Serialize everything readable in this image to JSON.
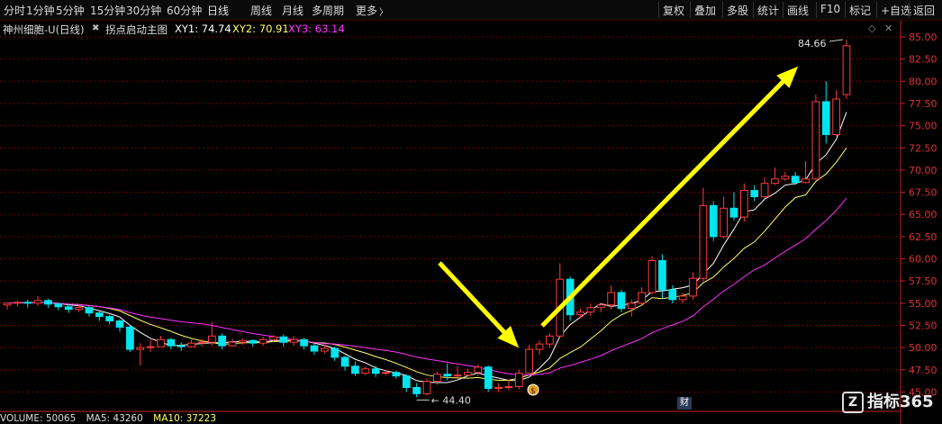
{
  "toolbar": {
    "tabs": [
      "分时",
      "1分钟",
      "5分钟",
      "15分钟",
      "30分钟",
      "60分钟",
      "日线",
      "周线",
      "月线",
      "多周期",
      "更多"
    ],
    "more_arrow": "〉",
    "right_buttons": [
      "复权",
      "叠加",
      "多股",
      "统计",
      "画线",
      "F10",
      "标记",
      "+自选",
      "返回"
    ]
  },
  "title": {
    "stock": "神州细胞-U(日线)",
    "indicator": "拐点启动主图",
    "xy1": "XY1: 74.74",
    "xy2": "XY2: 70.91",
    "xy3": "XY3: 63.14"
  },
  "colors": {
    "up": "#ff3b3b",
    "down": "#00e5ee",
    "ma1": "#ffffff",
    "ma2": "#ffff66",
    "ma3": "#ff33ff",
    "arrow": "#ffff00",
    "grid": "#7a0000",
    "axis": "#cc2222"
  },
  "annotations": {
    "high": "84.66",
    "low": "44.40"
  },
  "icons": {
    "settings": "diamond-icon",
    "close": "close-icon",
    "cash": "money-bag-icon"
  },
  "cai_label": "财",
  "watermark": "指标365",
  "volume": {
    "label": "VOLUME: 50065",
    "ma5": "MA5: 43260",
    "ma10": "MA10: 37223"
  },
  "chart_data": {
    "type": "candlestick",
    "ylim": [
      44.0,
      85.5
    ],
    "yticks": [
      "85.00",
      "82.50",
      "80.00",
      "77.50",
      "75.00",
      "72.50",
      "70.00",
      "67.50",
      "65.00",
      "62.50",
      "60.00",
      "57.50",
      "55.00",
      "52.50",
      "50.00",
      "47.50",
      "45.00"
    ],
    "candles": [
      [
        54.8,
        55.0,
        54.3,
        55.1
      ],
      [
        55.0,
        55.1,
        54.6,
        55.3
      ],
      [
        55.1,
        55.0,
        54.5,
        55.4
      ],
      [
        55.0,
        55.3,
        54.7,
        55.8
      ],
      [
        55.3,
        54.9,
        54.5,
        55.5
      ],
      [
        54.9,
        54.6,
        54.2,
        55.1
      ],
      [
        54.6,
        54.3,
        53.9,
        54.9
      ],
      [
        54.3,
        54.5,
        54.0,
        54.8
      ],
      [
        54.5,
        53.9,
        53.5,
        54.7
      ],
      [
        53.9,
        53.5,
        53.0,
        54.1
      ],
      [
        53.5,
        53.0,
        52.6,
        53.7
      ],
      [
        53.0,
        52.3,
        51.8,
        53.2
      ],
      [
        52.3,
        49.8,
        49.5,
        52.5
      ],
      [
        49.8,
        50.0,
        48.0,
        50.5
      ],
      [
        50.0,
        50.1,
        49.5,
        50.9
      ],
      [
        50.1,
        50.9,
        50.2,
        51.3
      ],
      [
        50.9,
        50.2,
        49.8,
        51.1
      ],
      [
        50.2,
        50.1,
        49.6,
        50.6
      ],
      [
        50.1,
        50.5,
        50.0,
        50.9
      ],
      [
        50.5,
        50.6,
        50.1,
        51.0
      ],
      [
        50.6,
        51.3,
        50.2,
        52.9
      ],
      [
        51.3,
        50.2,
        49.8,
        51.6
      ],
      [
        50.2,
        50.6,
        50.1,
        51.0
      ],
      [
        50.6,
        50.8,
        50.3,
        51.0
      ],
      [
        50.8,
        50.5,
        50.1,
        50.9
      ],
      [
        50.5,
        50.9,
        50.2,
        51.2
      ],
      [
        50.9,
        51.2,
        50.6,
        51.4
      ],
      [
        51.2,
        50.6,
        50.1,
        51.5
      ],
      [
        50.6,
        50.9,
        50.2,
        51.3
      ],
      [
        50.9,
        50.2,
        49.8,
        51.1
      ],
      [
        50.2,
        49.6,
        49.2,
        50.4
      ],
      [
        49.6,
        49.9,
        49.3,
        50.3
      ],
      [
        49.9,
        48.9,
        48.5,
        50.1
      ],
      [
        48.9,
        47.9,
        47.4,
        49.1
      ],
      [
        47.9,
        47.1,
        46.8,
        48.4
      ],
      [
        47.1,
        47.6,
        46.9,
        47.9
      ],
      [
        47.6,
        47.1,
        46.7,
        47.9
      ],
      [
        47.1,
        47.2,
        46.9,
        47.5
      ],
      [
        47.2,
        46.8,
        46.5,
        47.4
      ],
      [
        46.8,
        45.5,
        45.0,
        47.0
      ],
      [
        45.5,
        44.8,
        44.4,
        46.0
      ],
      [
        44.8,
        46.2,
        44.6,
        46.5
      ],
      [
        46.2,
        47.0,
        45.8,
        47.3
      ],
      [
        47.0,
        46.8,
        46.3,
        48.2
      ],
      [
        46.8,
        46.9,
        46.3,
        47.9
      ],
      [
        46.9,
        47.2,
        46.7,
        47.6
      ],
      [
        47.2,
        47.8,
        46.8,
        48.1
      ],
      [
        47.8,
        45.4,
        45.0,
        48.0
      ],
      [
        45.4,
        45.5,
        45.0,
        46.0
      ],
      [
        45.5,
        45.6,
        45.2,
        46.4
      ],
      [
        45.6,
        47.1,
        45.3,
        47.5
      ],
      [
        47.1,
        49.8,
        47.0,
        50.3
      ],
      [
        49.8,
        50.4,
        49.2,
        50.8
      ],
      [
        50.4,
        51.3,
        50.0,
        51.6
      ],
      [
        51.3,
        57.7,
        51.2,
        59.5
      ],
      [
        57.7,
        53.7,
        53.0,
        58.0
      ],
      [
        53.7,
        54.0,
        53.3,
        54.4
      ],
      [
        54.0,
        54.5,
        53.5,
        54.9
      ],
      [
        54.5,
        54.8,
        54.0,
        55.0
      ],
      [
        54.8,
        56.2,
        54.3,
        57.0
      ],
      [
        56.2,
        54.4,
        54.0,
        56.5
      ],
      [
        54.4,
        55.0,
        53.5,
        55.4
      ],
      [
        55.0,
        56.2,
        54.8,
        56.8
      ],
      [
        56.2,
        59.8,
        56.0,
        60.3
      ],
      [
        59.8,
        56.5,
        55.5,
        60.5
      ],
      [
        56.5,
        55.4,
        55.0,
        57.0
      ],
      [
        55.4,
        55.8,
        55.0,
        56.2
      ],
      [
        55.8,
        57.8,
        55.4,
        58.5
      ],
      [
        57.8,
        66.0,
        57.5,
        68.0
      ],
      [
        66.0,
        62.5,
        62.0,
        66.5
      ],
      [
        62.5,
        65.7,
        62.3,
        67.0
      ],
      [
        65.7,
        64.7,
        64.3,
        67.5
      ],
      [
        64.7,
        67.7,
        64.2,
        68.5
      ],
      [
        67.7,
        67.0,
        66.5,
        68.3
      ],
      [
        67.0,
        68.5,
        66.8,
        69.2
      ],
      [
        68.5,
        69.0,
        68.3,
        70.3
      ],
      [
        69.0,
        69.3,
        68.8,
        69.8
      ],
      [
        69.3,
        68.6,
        68.3,
        69.8
      ],
      [
        68.6,
        69.0,
        68.5,
        71.0
      ],
      [
        69.0,
        77.7,
        68.9,
        78.5
      ],
      [
        77.7,
        74.0,
        73.0,
        80.0
      ],
      [
        74.0,
        78.0,
        73.8,
        79.0
      ],
      [
        78.5,
        84.0,
        78.0,
        84.66
      ]
    ]
  }
}
